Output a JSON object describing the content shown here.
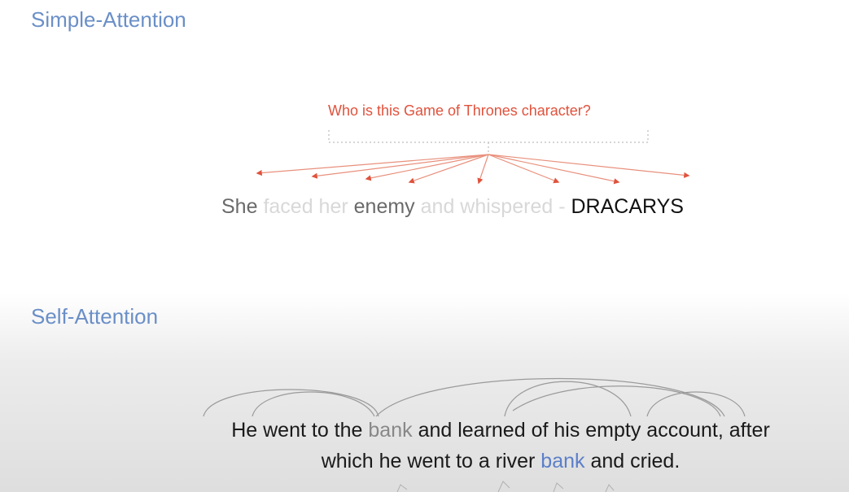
{
  "simple_attention": {
    "title": "Simple-Attention",
    "question": "Who is this Game of Thrones character?",
    "sentence": {
      "w1": "She",
      "w2": "faced her",
      "w3": "enemy",
      "w4": "and whispered -",
      "w5": "DRACARYS"
    }
  },
  "self_attention": {
    "title": "Self-Attention",
    "line1": {
      "a": "He went to the",
      "bank": "bank",
      "b": "and learned of his empty account, after"
    },
    "line2": {
      "a": "which he went to a river",
      "bank": "bank",
      "b": "and cried."
    }
  },
  "colors": {
    "title": "#6a8fc7",
    "question": "#e0523c",
    "bank_highlight": "#5b7fc9"
  }
}
